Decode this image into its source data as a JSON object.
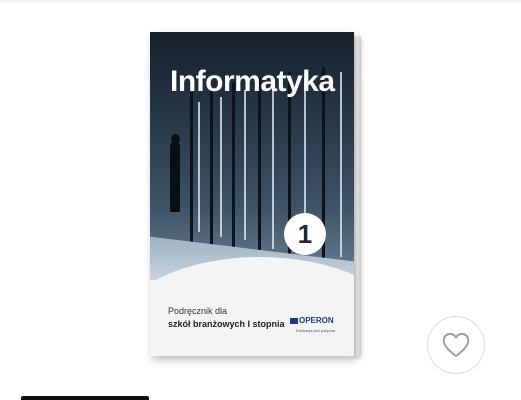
{
  "product": {
    "book_title": "Informatyka",
    "volume": "1",
    "subtitle_line1": "Podręcznik dla",
    "subtitle_line2": "szkół branżowych I stopnia",
    "publisher": "OPERON",
    "publisher_tagline": "Edukacja jest potężna"
  },
  "actions": {
    "wishlist_icon": "heart-outline-icon"
  },
  "colors": {
    "cover_dark": "#1c2a38",
    "publisher_blue": "#1f3f7a",
    "heart_stroke": "#9a9a9a"
  }
}
